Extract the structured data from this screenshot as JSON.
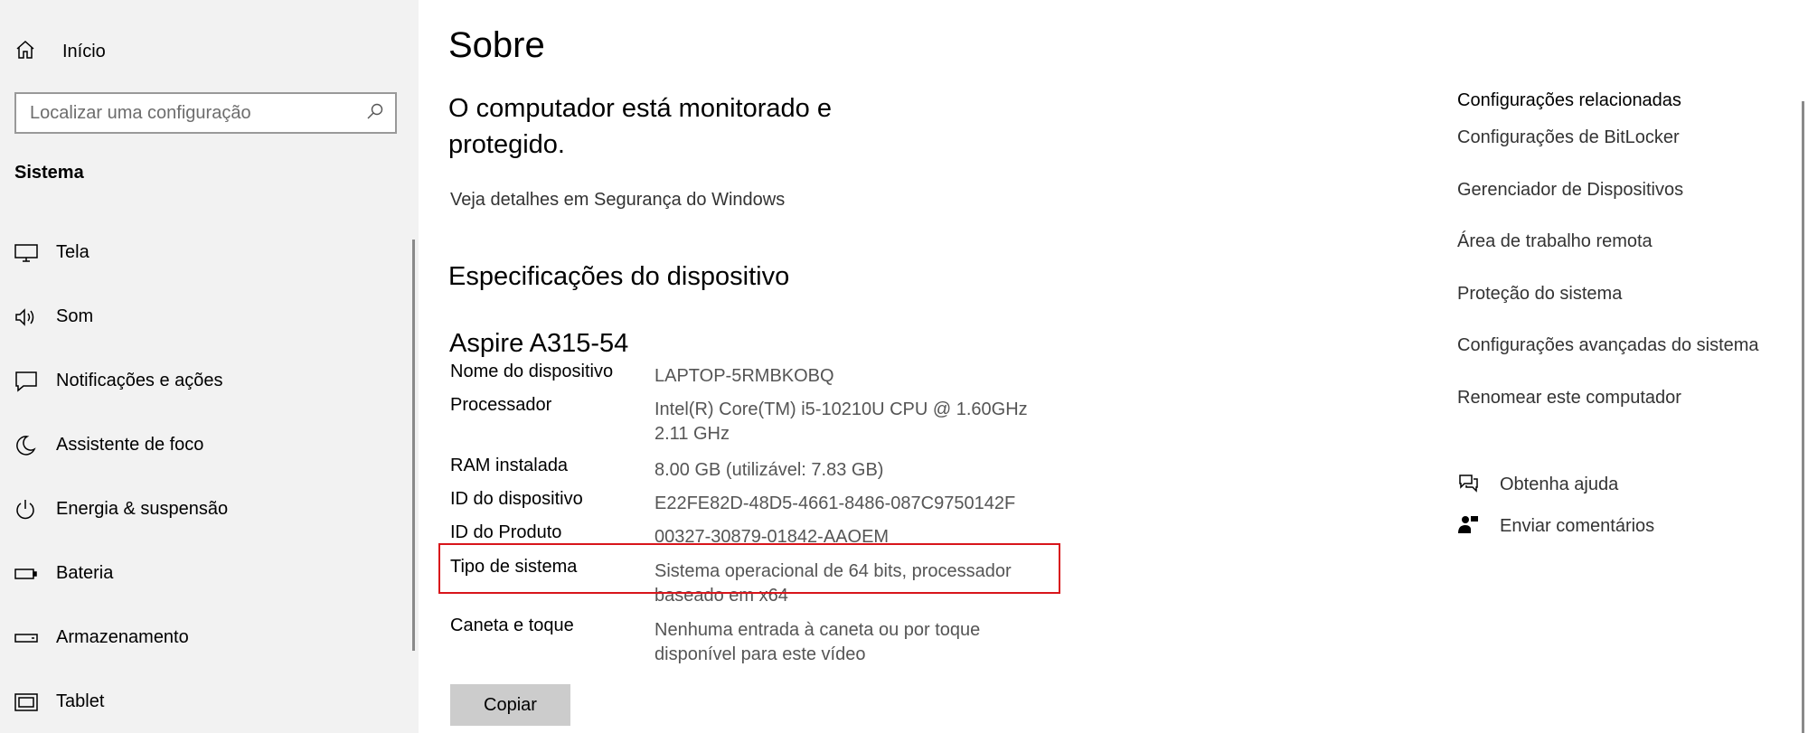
{
  "sidebar": {
    "home_label": "Início",
    "search_placeholder": "Localizar uma configuração",
    "section_title": "Sistema",
    "items": [
      {
        "label": "Tela",
        "icon": "display-icon"
      },
      {
        "label": "Som",
        "icon": "speaker-icon"
      },
      {
        "label": "Notificações e ações",
        "icon": "notifications-icon"
      },
      {
        "label": "Assistente de foco",
        "icon": "moon-icon"
      },
      {
        "label": "Energia & suspensão",
        "icon": "power-icon"
      },
      {
        "label": "Bateria",
        "icon": "battery-icon"
      },
      {
        "label": "Armazenamento",
        "icon": "storage-icon"
      },
      {
        "label": "Tablet",
        "icon": "tablet-icon"
      }
    ]
  },
  "main": {
    "title": "Sobre",
    "status": "O computador está monitorado e protegido.",
    "security_link": "Veja detalhes em Segurança do Windows",
    "specs_heading": "Especificações do dispositivo",
    "device_model": "Aspire A315-54",
    "specs": [
      {
        "key": "Nome do dispositivo",
        "value": "LAPTOP-5RMBKOBQ"
      },
      {
        "key": "Processador",
        "value": "Intel(R) Core(TM) i5-10210U CPU @ 1.60GHz 2.11 GHz"
      },
      {
        "key": "RAM instalada",
        "value": "8.00 GB (utilizável: 7.83 GB)"
      },
      {
        "key": "ID do dispositivo",
        "value": "E22FE82D-48D5-4661-8486-087C9750142F"
      },
      {
        "key": "ID do Produto",
        "value": "00327-30879-01842-AAOEM"
      },
      {
        "key": "Tipo de sistema",
        "value": "Sistema operacional de 64 bits, processador baseado em x64"
      },
      {
        "key": "Caneta e toque",
        "value": "Nenhuma entrada à caneta ou por toque disponível para este vídeo"
      }
    ],
    "copy_label": "Copiar"
  },
  "related": {
    "title": "Configurações relacionadas",
    "links": [
      "Configurações de BitLocker",
      "Gerenciador de Dispositivos",
      "Área de trabalho remota",
      "Proteção do sistema",
      "Configurações avançadas do sistema",
      "Renomear este computador"
    ],
    "help_label": "Obtenha ajuda",
    "feedback_label": "Enviar comentários"
  },
  "colors": {
    "sidebar_bg": "#f2f2f2",
    "highlight": "#d8151b",
    "button_bg": "#cccccc"
  }
}
